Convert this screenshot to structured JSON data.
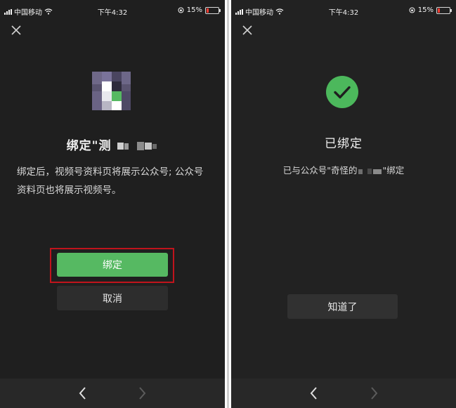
{
  "status_bar": {
    "carrier": "中国移动",
    "time": "下午4:32",
    "battery": "15%"
  },
  "left_screen": {
    "title_prefix": "绑定\"测",
    "description": "绑定后，视频号资料页将展示公众号; 公众号资料页也将展示视频号。",
    "bind_button": "绑定",
    "cancel_button": "取消"
  },
  "right_screen": {
    "title": "已绑定",
    "message_prefix": "已与公众号\"奇怪的",
    "message_suffix": "\"绑定",
    "ok_button": "知道了"
  },
  "colors": {
    "accent_green": "#56b962",
    "highlight_red": "#c0141c",
    "background": "#1f1f1f"
  },
  "icons": [
    "close-icon",
    "check-icon",
    "back-arrow-icon",
    "forward-arrow-icon",
    "wifi-icon",
    "battery-icon"
  ]
}
